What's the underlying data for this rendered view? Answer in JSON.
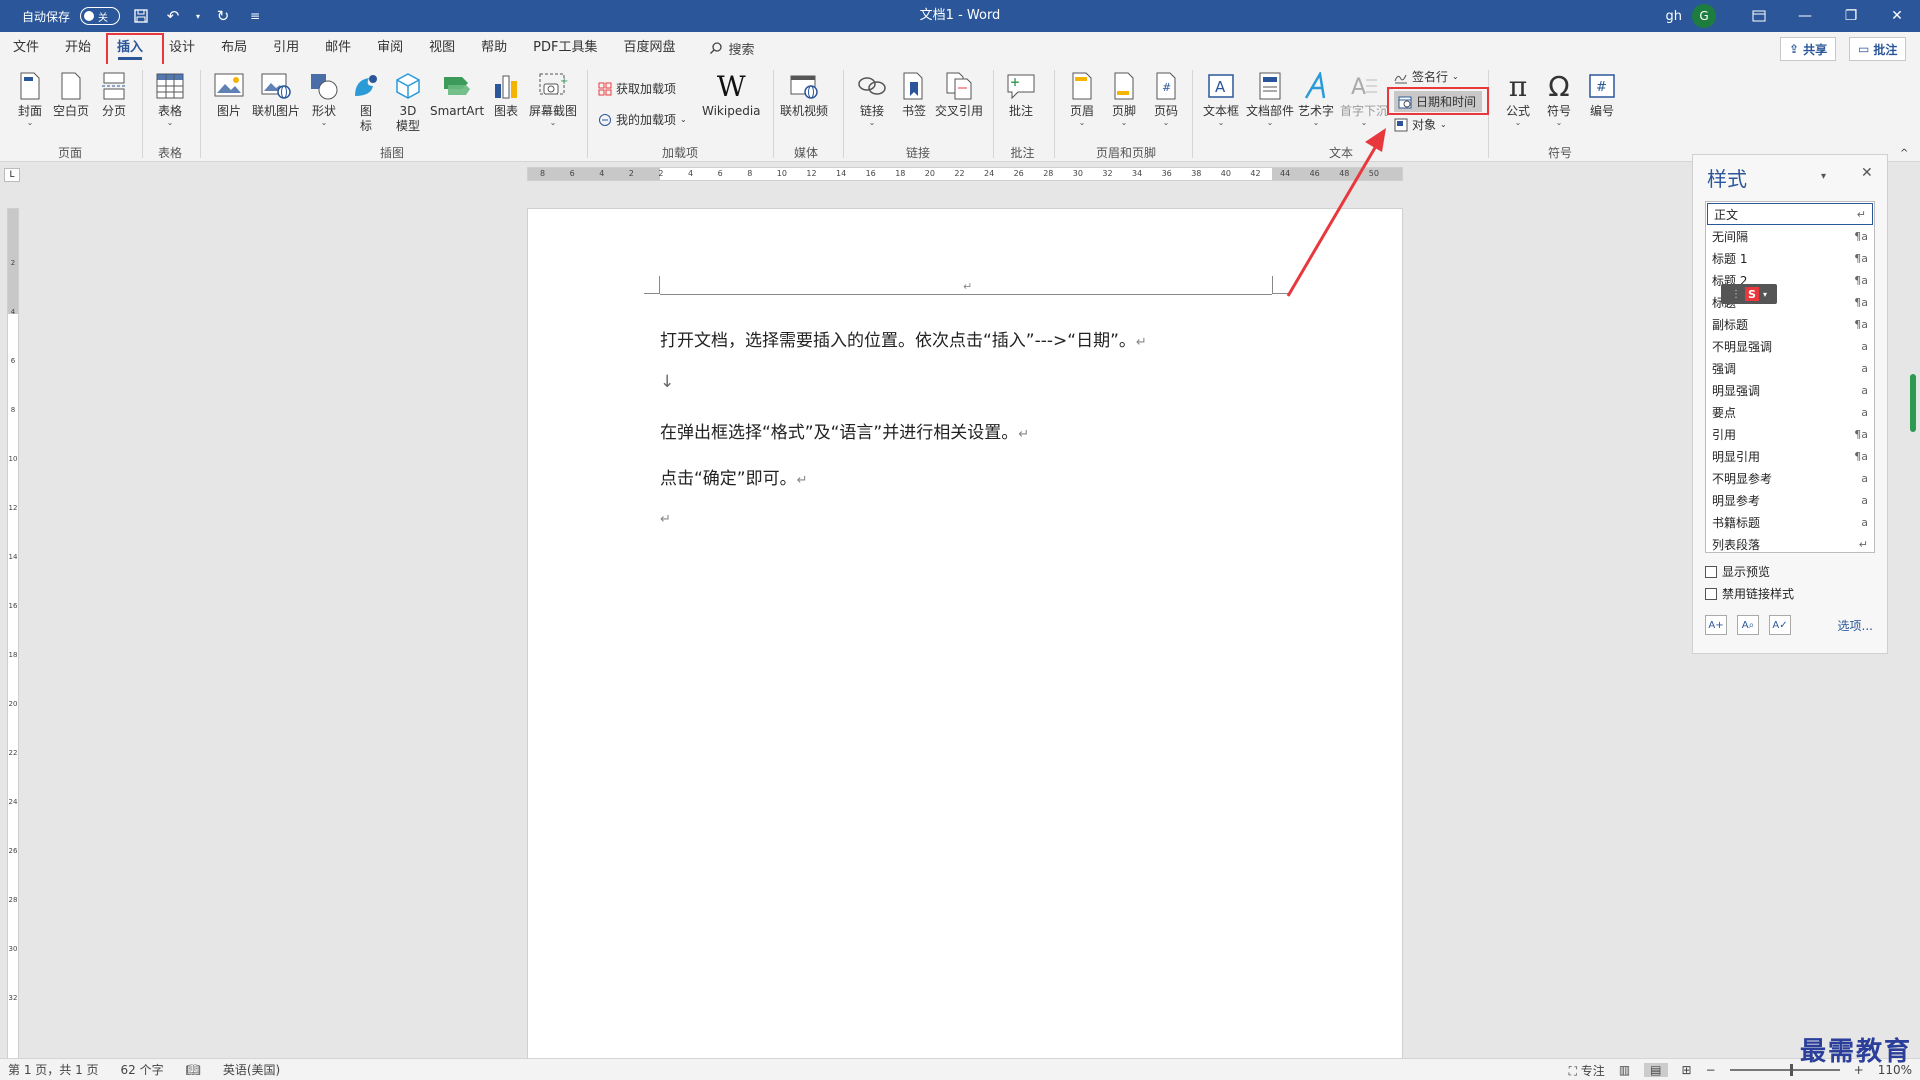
{
  "titlebar": {
    "autosave_label": "自动保存",
    "autosave_state": "关",
    "doc_title": "文档1 - Word",
    "user": "gh",
    "avatar_initial": "G"
  },
  "tabs": [
    "文件",
    "开始",
    "插入",
    "设计",
    "布局",
    "引用",
    "邮件",
    "审阅",
    "视图",
    "帮助",
    "PDF工具集",
    "百度网盘"
  ],
  "active_tab": "插入",
  "search_label": "搜索",
  "share_label": "共享",
  "comment_label": "批注",
  "ribbon": {
    "cover": "封面",
    "blank_page": "空白页",
    "page_break": "分页",
    "group_pages": "页面",
    "table": "表格",
    "group_tables": "表格",
    "picture": "图片",
    "online_picture": "联机图片",
    "shapes": "形状",
    "icons_1": "图",
    "icons_2": "标",
    "model3d_1": "3D",
    "model3d_2": "模型",
    "smartart": "SmartArt",
    "chart": "图表",
    "screenshot": "屏幕截图",
    "group_illustrations": "插图",
    "get_addins": "获取加载项",
    "my_addins": "我的加载项",
    "wikipedia": "Wikipedia",
    "group_addins": "加载项",
    "online_video": "联机视频",
    "group_media": "媒体",
    "link": "链接",
    "bookmark": "书签",
    "cross_ref": "交叉引用",
    "group_links": "链接",
    "comment": "批注",
    "group_comments": "批注",
    "header": "页眉",
    "footer": "页脚",
    "page_number": "页码",
    "group_header_footer": "页眉和页脚",
    "textbox": "文本框",
    "quick_parts": "文档部件",
    "wordart": "艺术字",
    "dropcap": "首字下沉",
    "signature_line": "签名行",
    "date_time": "日期和时间",
    "object": "对象",
    "group_text": "文本",
    "equation": "公式",
    "symbol": "符号",
    "number": "编号",
    "group_symbols": "符号"
  },
  "hruler_ticks": [
    "8",
    "6",
    "4",
    "2",
    "2",
    "4",
    "6",
    "8",
    "10",
    "12",
    "14",
    "16",
    "18",
    "20",
    "22",
    "24",
    "26",
    "28",
    "30",
    "32",
    "34",
    "36",
    "38",
    "40",
    "42",
    "44",
    "46",
    "48",
    "50"
  ],
  "vruler_ticks": [
    "2",
    "4",
    "6",
    "8",
    "10",
    "12",
    "14",
    "16",
    "18",
    "20",
    "22",
    "24",
    "26",
    "28",
    "30",
    "32"
  ],
  "document": {
    "line1": "打开文档，选择需要插入的位置。依次点击“插入”--->“日期”。",
    "line2": "↓",
    "line3": "在弹出框选择“格式”及“语言”并进行相关设置。",
    "line4": "点击“确定”即可。",
    "para_mark": "↵"
  },
  "styles_pane": {
    "title": "样式",
    "items": [
      {
        "name": "正文",
        "mark": "↵"
      },
      {
        "name": "无间隔",
        "mark": "¶a"
      },
      {
        "name": "标题 1",
        "mark": "¶a"
      },
      {
        "name": "标题 2",
        "mark": "¶a"
      },
      {
        "name": "标题",
        "mark": "¶a"
      },
      {
        "name": "副标题",
        "mark": "¶a"
      },
      {
        "name": "不明显强调",
        "mark": "a"
      },
      {
        "name": "强调",
        "mark": "a"
      },
      {
        "name": "明显强调",
        "mark": "a"
      },
      {
        "name": "要点",
        "mark": "a"
      },
      {
        "name": "引用",
        "mark": "¶a"
      },
      {
        "name": "明显引用",
        "mark": "¶a"
      },
      {
        "name": "不明显参考",
        "mark": "a"
      },
      {
        "name": "明显参考",
        "mark": "a"
      },
      {
        "name": "书籍标题",
        "mark": "a"
      },
      {
        "name": "列表段落",
        "mark": "↵"
      }
    ],
    "show_preview": "显示预览",
    "disable_linked": "禁用链接样式",
    "options": "选项..."
  },
  "statusbar": {
    "page": "第 1 页，共 1 页",
    "words": "62 个字",
    "language": "英语(美国)",
    "focus": "专注",
    "zoom": "110%"
  },
  "watermark": "最需教育",
  "colors": {
    "accent": "#2b579a",
    "highlight": "#e8383d"
  }
}
